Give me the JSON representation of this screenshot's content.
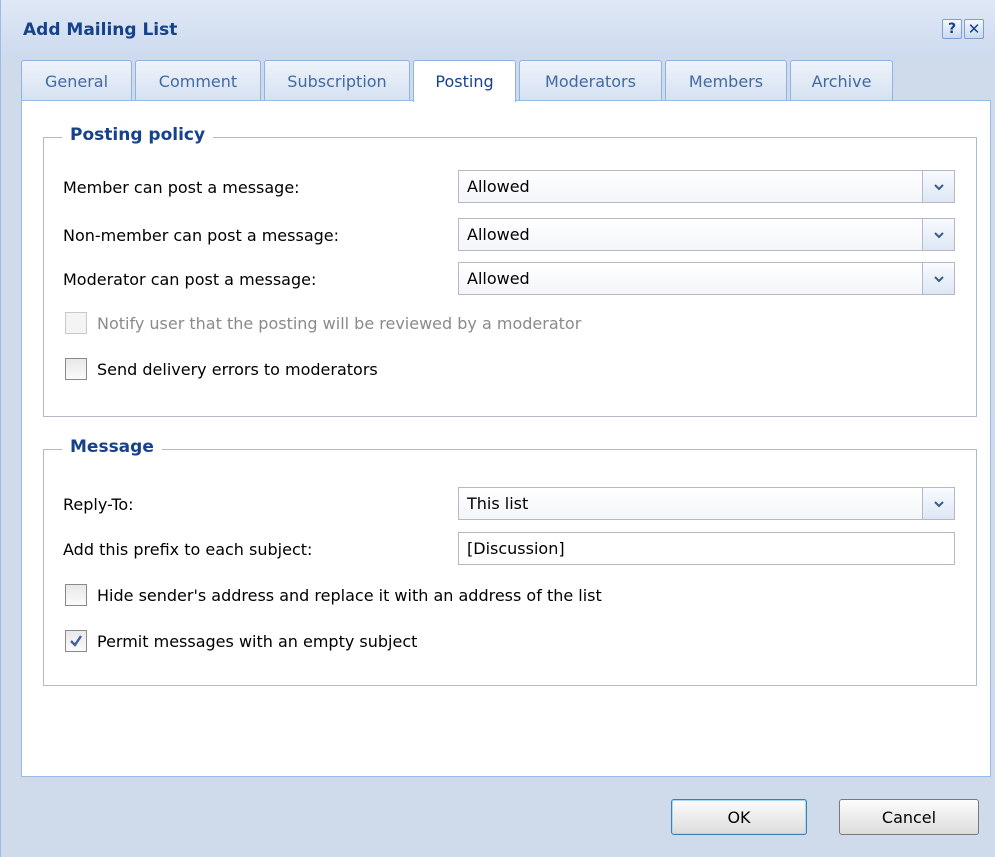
{
  "window": {
    "title": "Add Mailing List",
    "help_label": "?",
    "close_label": "✕"
  },
  "tabs": [
    {
      "label": "General"
    },
    {
      "label": "Comment"
    },
    {
      "label": "Subscription"
    },
    {
      "label": "Posting"
    },
    {
      "label": "Moderators"
    },
    {
      "label": "Members"
    },
    {
      "label": "Archive"
    }
  ],
  "active_tab": "Posting",
  "posting_policy": {
    "legend": "Posting policy",
    "member": {
      "label": "Member can post a message:",
      "value": "Allowed"
    },
    "non_member": {
      "label": "Non-member can post a message:",
      "value": "Allowed"
    },
    "moderator": {
      "label": "Moderator can post a message:",
      "value": "Allowed"
    },
    "notify": {
      "label": "Notify user that the posting will be reviewed by a moderator",
      "checked": false,
      "disabled": true
    },
    "delivery_errors": {
      "label": "Send delivery errors to moderators",
      "checked": false
    }
  },
  "message": {
    "legend": "Message",
    "reply_to": {
      "label": "Reply-To:",
      "value": "This list"
    },
    "prefix": {
      "label": "Add this prefix to each subject:",
      "value": "[Discussion]"
    },
    "hide_sender": {
      "label": "Hide sender's address and replace it with an address of the list",
      "checked": false
    },
    "permit_empty": {
      "label": "Permit messages with an empty subject",
      "checked": true
    }
  },
  "buttons": {
    "ok": "OK",
    "cancel": "Cancel"
  },
  "colors": {
    "header_text": "#15428b",
    "tab_border": "#99bbe8",
    "dialog_bg": "#cfdbeb"
  }
}
